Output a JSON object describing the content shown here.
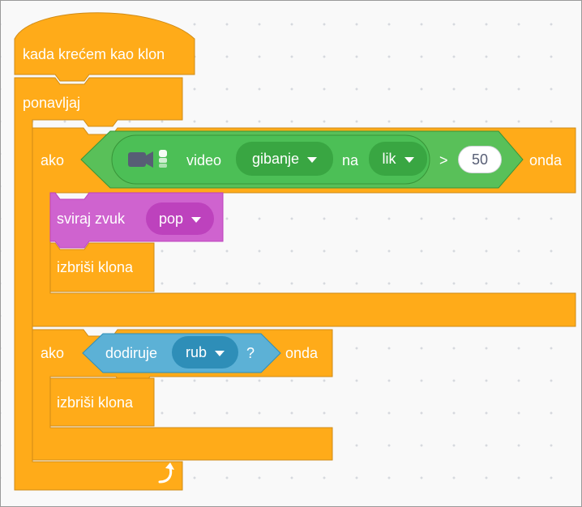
{
  "colors": {
    "control": "#ffab19",
    "control_stroke": "#cf8b17",
    "video": "#4cbf56",
    "video_stroke": "#389438",
    "video_dark": "#39a642",
    "sound": "#cf63cf",
    "sound_dark": "#bd42bd",
    "sound_stroke": "#bd42bd",
    "sensing": "#5cb1d6",
    "sensing_dark": "#2e8eb8",
    "sensing_stroke": "#2e8eb8",
    "operator": "#59c059"
  },
  "hat_block": {
    "label": "kada krećem kao klon"
  },
  "forever_block": {
    "label": "ponavljaj",
    "loop_icon": "loop-arrow-icon"
  },
  "if_block_1": {
    "if_label": "ako",
    "then_label": "onda",
    "condition": {
      "operator": ">",
      "video_icon": "video-sensing-icon",
      "video_label": "video",
      "attribute_value": "gibanje",
      "on_label": "na",
      "target_value": "lik",
      "threshold": "50"
    },
    "body": {
      "play_sound_label": "sviraj zvuk",
      "sound_value": "pop",
      "delete_clone_label": "izbriši klona"
    }
  },
  "if_block_2": {
    "if_label": "ako",
    "then_label": "onda",
    "condition": {
      "touching_label": "dodiruje",
      "touching_value": "rub",
      "question_mark": "?"
    },
    "body": {
      "delete_clone_label": "izbriši klona"
    }
  }
}
